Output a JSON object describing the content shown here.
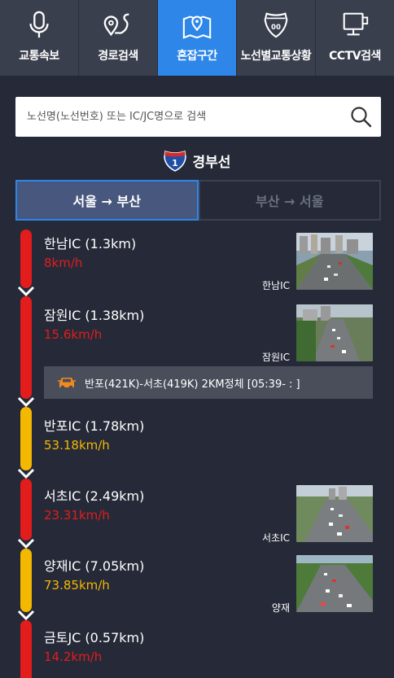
{
  "nav": {
    "items": [
      {
        "label": "교통속보",
        "icon": "microphone-icon"
      },
      {
        "label": "경로검색",
        "icon": "route-icon"
      },
      {
        "label": "혼잡구간",
        "icon": "map-pin-icon"
      },
      {
        "label": "노선별교통상황",
        "icon": "highway-shield-icon"
      },
      {
        "label": "CCTV검색",
        "icon": "cctv-camera-icon"
      }
    ],
    "active_index": 2
  },
  "search": {
    "placeholder": "노선명(노선번호) 또는 IC/JC명으로 검색"
  },
  "route": {
    "number": "1",
    "name": "경부선"
  },
  "direction_tabs": {
    "active": "서울 → 부산",
    "inactive": "부산 → 서울"
  },
  "colors": {
    "accent": "#2d86e8",
    "congested": "#e31c1c",
    "slow": "#f5b800",
    "background": "#262a38"
  },
  "sections": [
    {
      "name": "한남IC (1.3km)",
      "speed": "8km/h",
      "status": "congested",
      "cctv_label": "한남IC"
    },
    {
      "name": "잠원IC (1.38km)",
      "speed": "15.6km/h",
      "status": "congested",
      "cctv_label": "잠원IC"
    },
    {
      "name": "반포IC (1.78km)",
      "speed": "53.18km/h",
      "status": "slow",
      "cctv_label": ""
    },
    {
      "name": "서초IC (2.49km)",
      "speed": "23.31km/h",
      "status": "congested",
      "cctv_label": "서초IC"
    },
    {
      "name": "양재IC (7.05km)",
      "speed": "73.85km/h",
      "status": "slow",
      "cctv_label": "양재"
    },
    {
      "name": "금토JC (0.57km)",
      "speed": "14.2km/h",
      "status": "congested",
      "cctv_label": ""
    }
  ],
  "incident": {
    "text": "반포(421K)-서초(419K) 2KM정체 [05:39- : ]",
    "icon": "car-icon"
  }
}
